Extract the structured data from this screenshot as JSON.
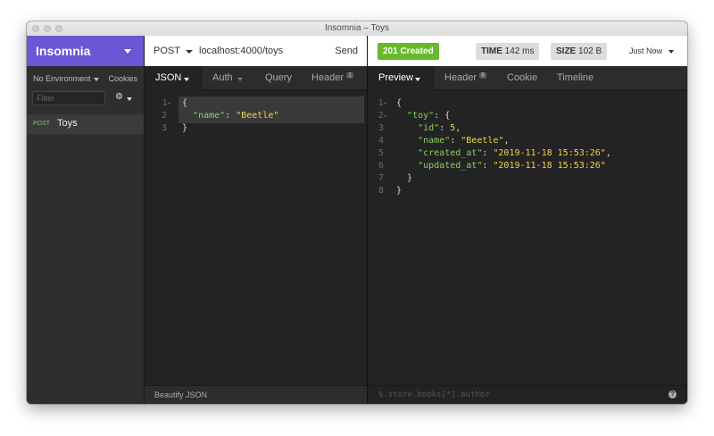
{
  "window": {
    "title": "Insomnia – Toys"
  },
  "sidebar": {
    "brand": "Insomnia",
    "environment": "No Environment",
    "cookies": "Cookies",
    "filter_placeholder": "Filter",
    "gear_icon": "gear-icon",
    "requests": [
      {
        "method": "POST",
        "name": "Toys"
      }
    ]
  },
  "request": {
    "method": "POST",
    "url": "localhost:4000/toys",
    "send_label": "Send",
    "tabs": [
      {
        "label": "JSON",
        "active": true
      },
      {
        "label": "Auth"
      },
      {
        "label": "Query"
      },
      {
        "label": "Header",
        "count": "1"
      }
    ],
    "body_lines": [
      "{",
      "  \"name\": \"Beetle\"",
      "}"
    ],
    "line_numbers": [
      "1",
      "2",
      "3"
    ],
    "footer_label": "Beautify JSON"
  },
  "response": {
    "status": "201 Created",
    "time_label": "TIME",
    "time_value": "142 ms",
    "size_label": "SIZE",
    "size_value": "102 B",
    "when": "Just Now",
    "tabs": [
      {
        "label": "Preview",
        "active": true
      },
      {
        "label": "Header",
        "count": "6"
      },
      {
        "label": "Cookie"
      },
      {
        "label": "Timeline"
      }
    ],
    "line_numbers": [
      "1",
      "2",
      "3",
      "4",
      "5",
      "6",
      "7",
      "8"
    ],
    "body_lines": [
      "{",
      "  \"toy\": {",
      "    \"id\": 5,",
      "    \"name\": \"Beetle\",",
      "    \"created_at\": \"2019-11-18 15:53:26\",",
      "    \"updated_at\": \"2019-11-18 15:53:26\"",
      "  }",
      "}"
    ],
    "filter_placeholder": "$.store.books[*].author"
  },
  "colors": {
    "brand": "#6a57d5",
    "success": "#68b82c",
    "json_key": "#8ccf5c",
    "json_string": "#f3d34c"
  }
}
